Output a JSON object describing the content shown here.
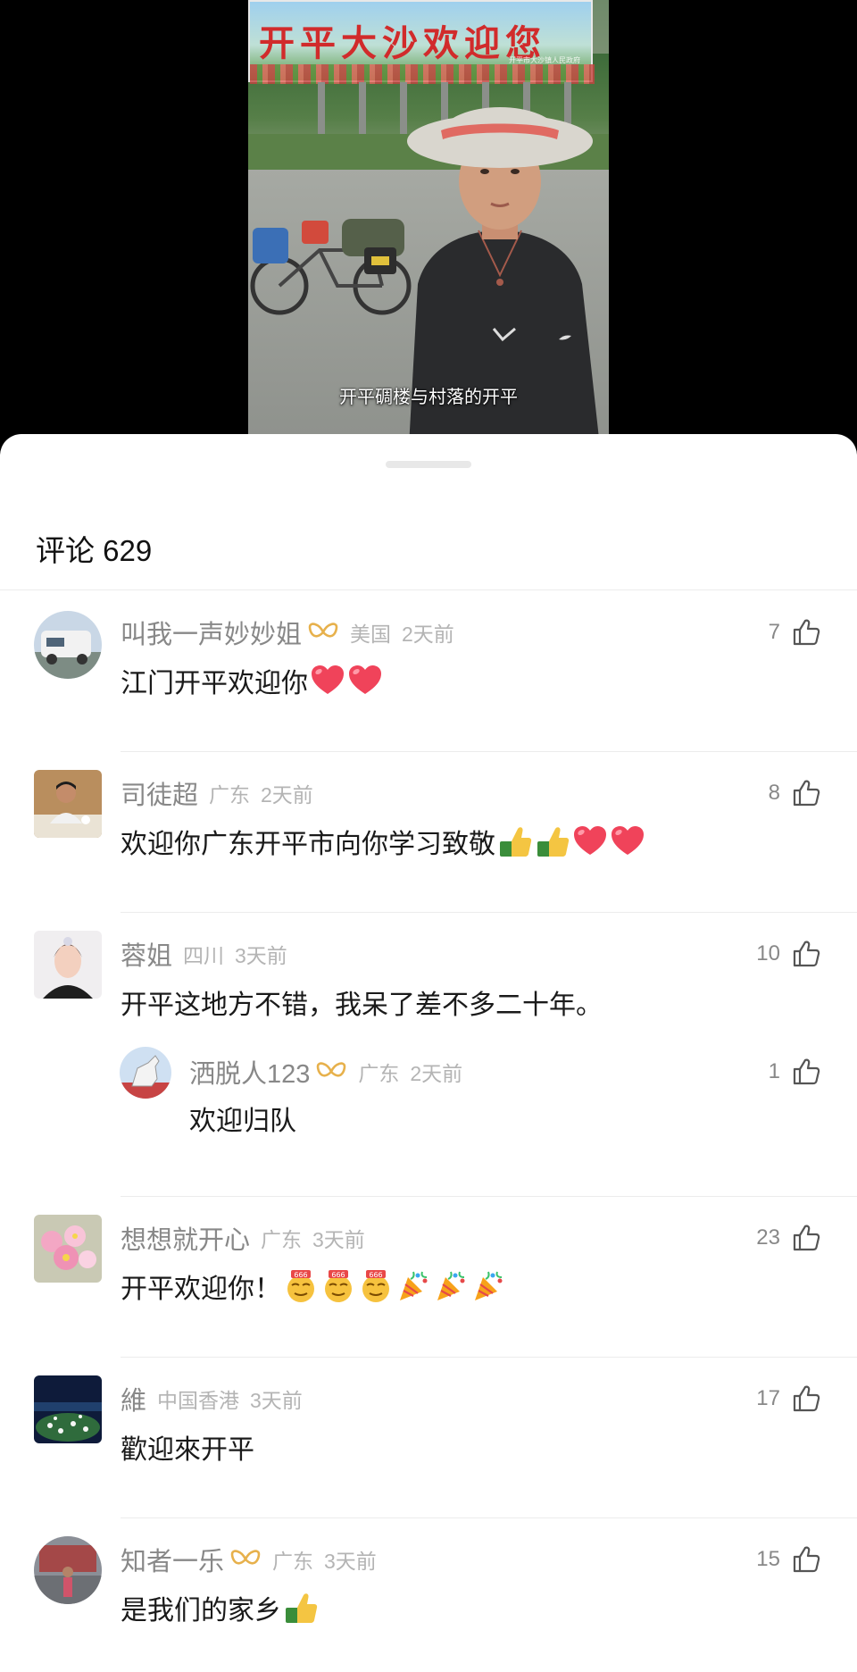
{
  "video": {
    "banner_text": "开平大沙欢迎您",
    "banner_subtext": "开平市大沙镇人民政府",
    "caption": "开平碉楼与村落的开平"
  },
  "comments_header": {
    "label": "评论",
    "count": "629"
  },
  "colors": {
    "name_gray": "#888888",
    "meta_gray": "#b4b4b4",
    "badge_gold": "#e7b14c",
    "heart_red": "#f0435a",
    "divider": "#ececec"
  },
  "comments": [
    {
      "name": "叫我一声妙妙姐",
      "has_badge": true,
      "location": "美国",
      "time": "2天前",
      "likes": "7",
      "text": "江门开平欢迎你",
      "emojis": [
        "heart-emoji",
        "heart-emoji"
      ]
    },
    {
      "name": "司徒超",
      "has_badge": false,
      "location": "广东",
      "time": "2天前",
      "likes": "8",
      "text": "欢迎你广东开平市向你学习致敬",
      "emojis": [
        "thumbs-up-emoji",
        "thumbs-up-emoji",
        "heart-emoji",
        "heart-emoji"
      ]
    },
    {
      "name": "蓉姐",
      "has_badge": false,
      "location": "四川",
      "time": "3天前",
      "likes": "10",
      "text": "开平这地方不错，我呆了差不多二十年。",
      "reply": {
        "name": "洒脱人123",
        "has_badge": true,
        "location": "广东",
        "time": "2天前",
        "likes": "1",
        "text": "欢迎归队"
      }
    },
    {
      "name": "想想就开心",
      "has_badge": false,
      "location": "广东",
      "time": "3天前",
      "likes": "23",
      "text": "开平欢迎你！",
      "emojis": [
        "666-emoji",
        "666-emoji",
        "666-emoji",
        "party-popper-emoji",
        "party-popper-emoji",
        "party-popper-emoji"
      ]
    },
    {
      "name": "維",
      "has_badge": false,
      "location": "中国香港",
      "time": "3天前",
      "likes": "17",
      "text": "歡迎來开平"
    },
    {
      "name": "知者一乐",
      "has_badge": true,
      "location": "广东",
      "time": "3天前",
      "likes": "15",
      "text": "是我们的家乡",
      "emojis": [
        "thumbs-up-emoji"
      ]
    }
  ]
}
